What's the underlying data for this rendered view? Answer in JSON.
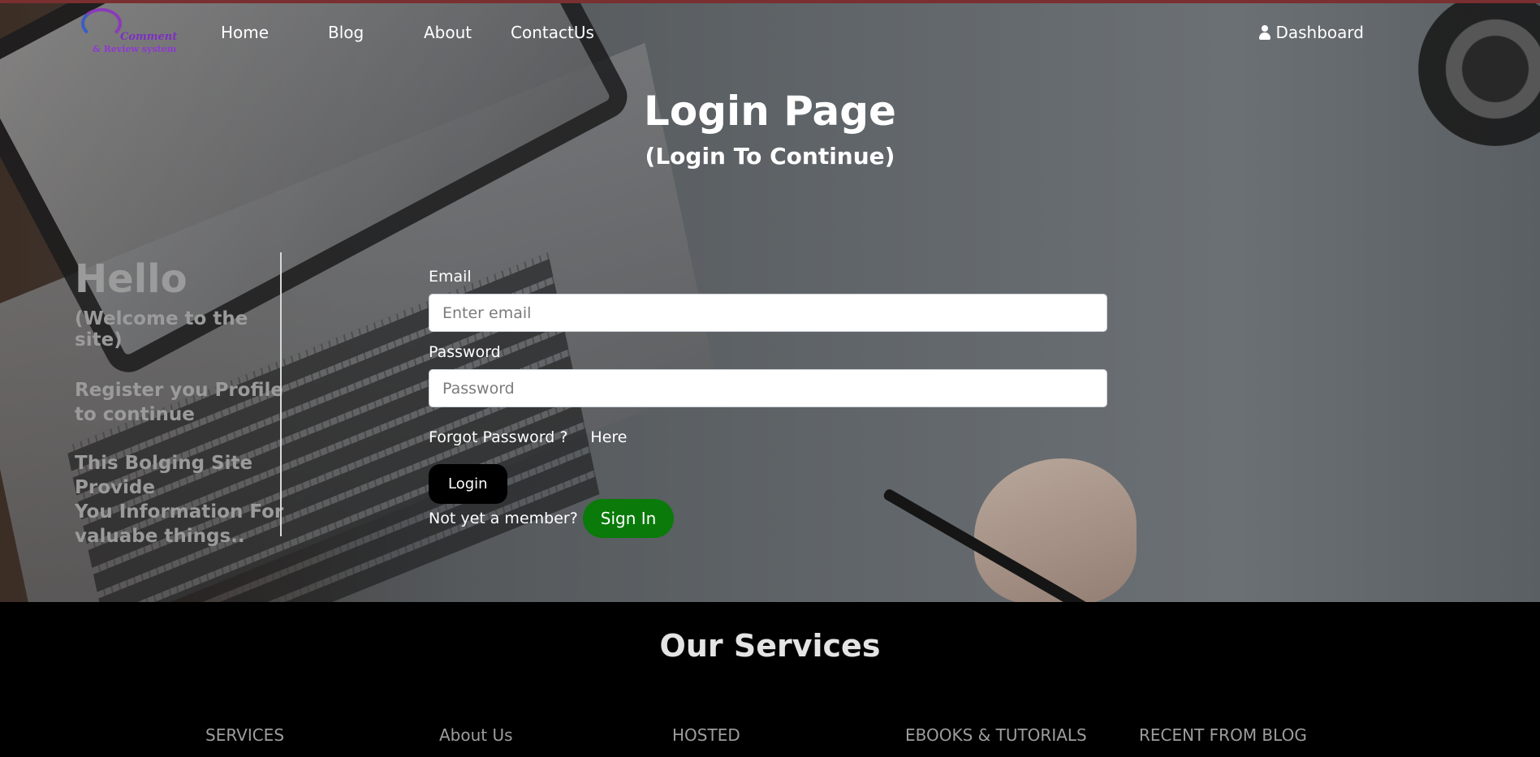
{
  "brand": {
    "logo_line1": "Comment",
    "logo_line2": "& Review system"
  },
  "nav": {
    "items": [
      {
        "label": "Home"
      },
      {
        "label": "Blog"
      },
      {
        "label": "About"
      },
      {
        "label": "ContactUs"
      }
    ],
    "dashboard_label": "Dashboard",
    "dashboard_icon": "user-icon"
  },
  "hero": {
    "title": "Login Page",
    "subtitle": "(Login To Continue)"
  },
  "left_panel": {
    "hello": "Hello",
    "welcome": "(Welcome to the site)",
    "register": "Register you Profile to continue",
    "site_line1": "This Bolging Site Provide",
    "site_line2": "You Information For valuabe things.."
  },
  "form": {
    "email_label": "Email",
    "email_placeholder": "Enter email",
    "email_value": "",
    "password_label": "Password",
    "password_placeholder": "Password",
    "password_value": "",
    "forgot_text": "Forgot Password ?",
    "here_link": "Here",
    "login_button": "Login",
    "member_text": "Not yet a member?",
    "signin_button": "Sign In"
  },
  "footer": {
    "title": "Our Services",
    "columns": [
      "SERVICES",
      "About Us",
      "HOSTED",
      "EBOOKS & TUTORIALS",
      "RECENT FROM BLOG"
    ]
  },
  "colors": {
    "accent_top_line": "#7a2f30",
    "signin_green": "#0a7a0a",
    "logo_purple": "#7d2fc1"
  }
}
